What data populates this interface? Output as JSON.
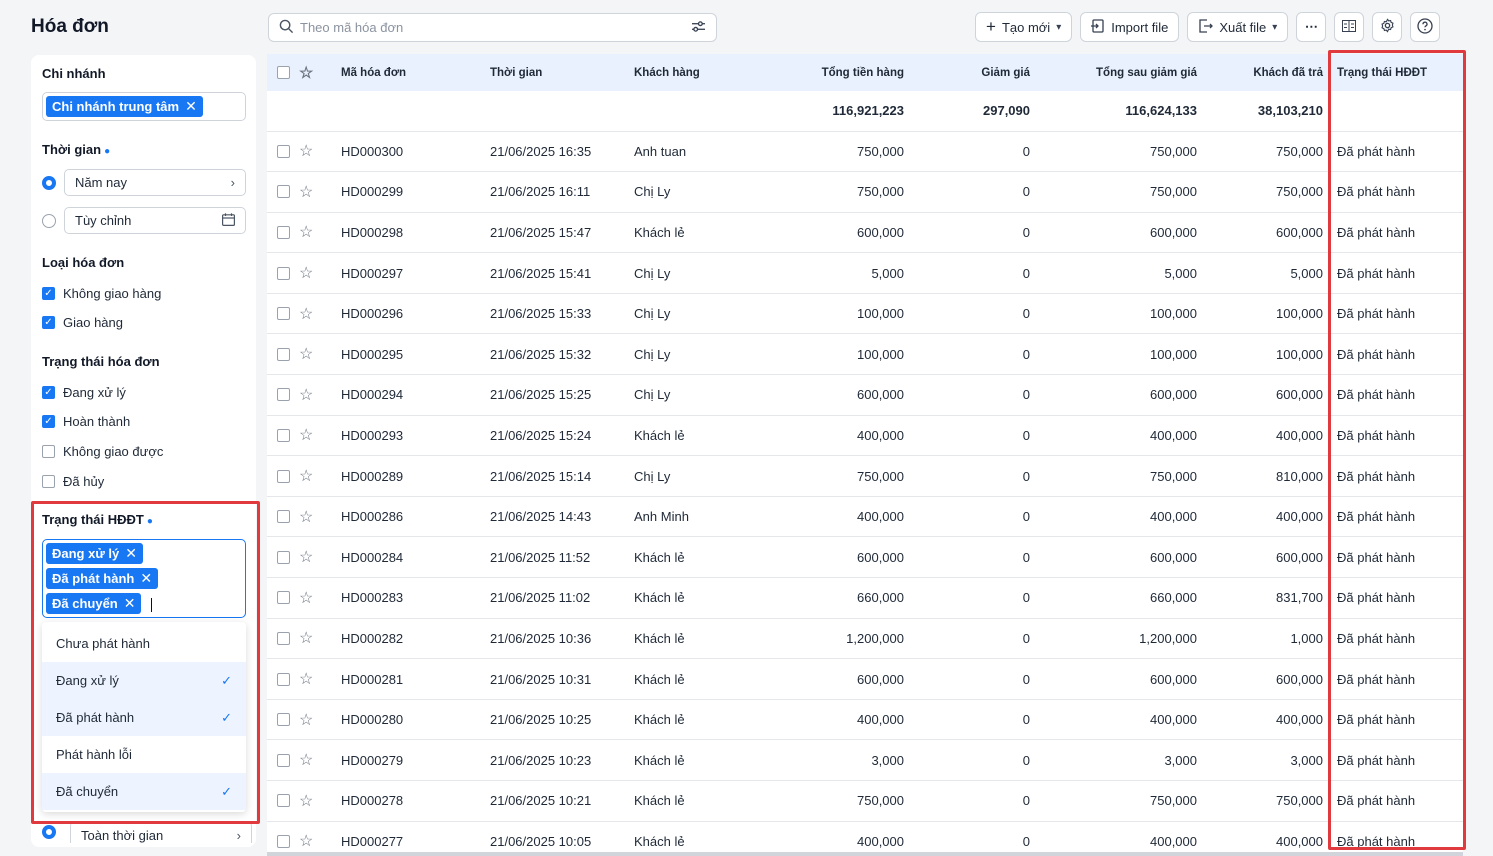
{
  "page": {
    "title": "Hóa đơn"
  },
  "search": {
    "placeholder": "Theo mã hóa đơn"
  },
  "toolbar": {
    "create_label": "Tạo mới",
    "import_label": "Import file",
    "export_label": "Xuất file"
  },
  "sidebar": {
    "branch": {
      "title": "Chi nhánh",
      "tag": "Chi nhánh trung tâm"
    },
    "time": {
      "title": "Thời gian",
      "option_1": "Năm nay",
      "option_2": "Tùy chỉnh"
    },
    "invoice_type": {
      "title": "Loại hóa đơn",
      "items": [
        {
          "label": "Không giao hàng",
          "checked": true
        },
        {
          "label": "Giao hàng",
          "checked": true
        }
      ]
    },
    "invoice_status": {
      "title": "Trạng thái hóa đơn",
      "items": [
        {
          "label": "Đang xử lý",
          "checked": true
        },
        {
          "label": "Hoàn thành",
          "checked": true
        },
        {
          "label": "Không giao được",
          "checked": false
        },
        {
          "label": "Đã hủy",
          "checked": false
        }
      ]
    },
    "einvoice_status": {
      "title": "Trạng thái HĐĐT",
      "tags": [
        "Đang xử lý",
        "Đã phát hành",
        "Đã chuyển"
      ]
    },
    "dropdown_options": [
      {
        "label": "Chưa phát hành",
        "selected": false
      },
      {
        "label": "Đang xử lý",
        "selected": true
      },
      {
        "label": "Đã phát hành",
        "selected": true
      },
      {
        "label": "Phát hành lỗi",
        "selected": false
      },
      {
        "label": "Đã chuyển",
        "selected": true
      }
    ],
    "bottom_option": "Toàn thời gian"
  },
  "table": {
    "headers": [
      "Mã hóa đơn",
      "Thời gian",
      "Khách hàng",
      "Tổng tiền hàng",
      "Giảm giá",
      "Tổng sau giảm giá",
      "Khách đã trả",
      "Trạng thái HĐĐT"
    ],
    "totals": [
      "116,921,223",
      "297,090",
      "116,624,133",
      "38,103,210"
    ],
    "rows": [
      [
        "HD000300",
        "21/06/2025 16:35",
        "Anh tuan",
        "750,000",
        "0",
        "750,000",
        "750,000",
        "Đã phát hành"
      ],
      [
        "HD000299",
        "21/06/2025 16:11",
        "Chị Ly",
        "750,000",
        "0",
        "750,000",
        "750,000",
        "Đã phát hành"
      ],
      [
        "HD000298",
        "21/06/2025 15:47",
        "Khách lẻ",
        "600,000",
        "0",
        "600,000",
        "600,000",
        "Đã phát hành"
      ],
      [
        "HD000297",
        "21/06/2025 15:41",
        "Chị Ly",
        "5,000",
        "0",
        "5,000",
        "5,000",
        "Đã phát hành"
      ],
      [
        "HD000296",
        "21/06/2025 15:33",
        "Chị Ly",
        "100,000",
        "0",
        "100,000",
        "100,000",
        "Đã phát hành"
      ],
      [
        "HD000295",
        "21/06/2025 15:32",
        "Chị Ly",
        "100,000",
        "0",
        "100,000",
        "100,000",
        "Đã phát hành"
      ],
      [
        "HD000294",
        "21/06/2025 15:25",
        "Chị Ly",
        "600,000",
        "0",
        "600,000",
        "600,000",
        "Đã phát hành"
      ],
      [
        "HD000293",
        "21/06/2025 15:24",
        "Khách lẻ",
        "400,000",
        "0",
        "400,000",
        "400,000",
        "Đã phát hành"
      ],
      [
        "HD000289",
        "21/06/2025 15:14",
        "Chị Ly",
        "750,000",
        "0",
        "750,000",
        "810,000",
        "Đã phát hành"
      ],
      [
        "HD000286",
        "21/06/2025 14:43",
        "Anh Minh",
        "400,000",
        "0",
        "400,000",
        "400,000",
        "Đã phát hành"
      ],
      [
        "HD000284",
        "21/06/2025 11:52",
        "Khách lẻ",
        "600,000",
        "0",
        "600,000",
        "600,000",
        "Đã phát hành"
      ],
      [
        "HD000283",
        "21/06/2025 11:02",
        "Khách lẻ",
        "660,000",
        "0",
        "660,000",
        "831,700",
        "Đã phát hành"
      ],
      [
        "HD000282",
        "21/06/2025 10:36",
        "Khách lẻ",
        "1,200,000",
        "0",
        "1,200,000",
        "1,000",
        "Đã phát hành"
      ],
      [
        "HD000281",
        "21/06/2025 10:31",
        "Khách lẻ",
        "600,000",
        "0",
        "600,000",
        "600,000",
        "Đã phát hành"
      ],
      [
        "HD000280",
        "21/06/2025 10:25",
        "Khách lẻ",
        "400,000",
        "0",
        "400,000",
        "400,000",
        "Đã phát hành"
      ],
      [
        "HD000279",
        "21/06/2025 10:23",
        "Khách lẻ",
        "3,000",
        "0",
        "3,000",
        "3,000",
        "Đã phát hành"
      ],
      [
        "HD000278",
        "21/06/2025 10:21",
        "Khách lẻ",
        "750,000",
        "0",
        "750,000",
        "750,000",
        "Đã phát hành"
      ],
      [
        "HD000277",
        "21/06/2025 10:05",
        "Khách lẻ",
        "400,000",
        "0",
        "400,000",
        "400,000",
        "Đã phát hành"
      ]
    ]
  },
  "colors": {
    "accent": "#1877f2",
    "highlight": "#e0393e",
    "header_bg": "#e8f1fd"
  }
}
